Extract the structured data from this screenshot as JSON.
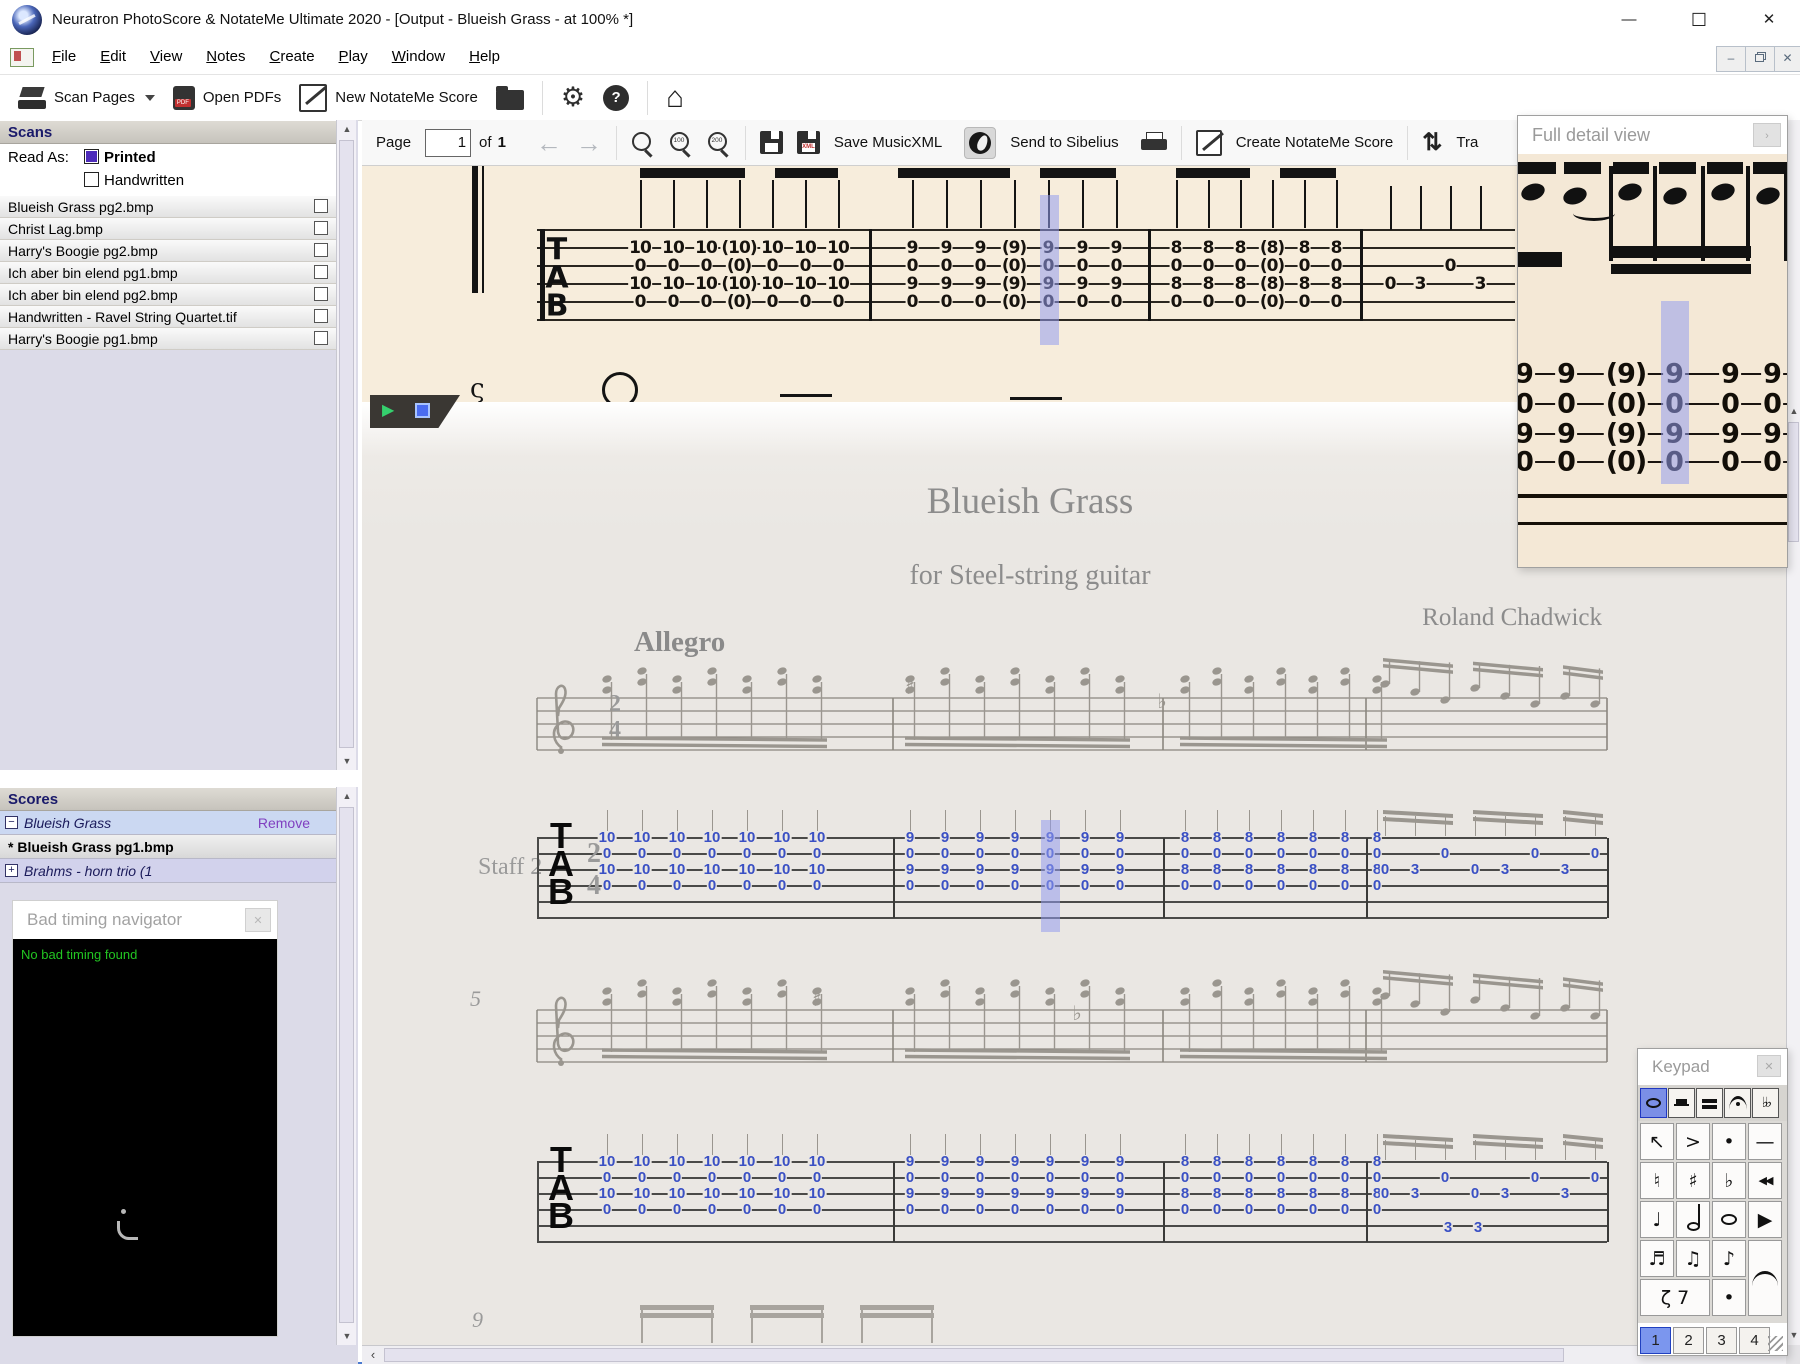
{
  "window": {
    "title": "Neuratron PhotoScore & NotateMe Ultimate 2020 - [Output - Blueish Grass - at 100% *]",
    "minimize_glyph": "—",
    "maximize_glyph": "☐",
    "close_glyph": "✕"
  },
  "menubar": {
    "items": [
      "File",
      "Edit",
      "View",
      "Notes",
      "Create",
      "Play",
      "Window",
      "Help"
    ]
  },
  "toolbar": {
    "scan_pages": "Scan Pages",
    "open_pdfs": "Open PDFs",
    "new_notateme": "New NotateMe Score"
  },
  "scans": {
    "title": "Scans",
    "read_as": "Read As:",
    "options": [
      {
        "label": "Printed",
        "checked": true
      },
      {
        "label": "Handwritten",
        "checked": false
      }
    ],
    "files": [
      "Blueish Grass pg2.bmp",
      "Christ Lag.bmp",
      "Harry's Boogie pg2.bmp",
      "Ich aber bin elend pg1.bmp",
      "Ich aber bin elend pg2.bmp",
      "Handwritten - Ravel String Quartet.tif",
      "Harry's Boogie pg1.bmp"
    ]
  },
  "scores": {
    "title": "Scores",
    "rows": [
      {
        "expander": "−",
        "label": "Blueish Grass",
        "italic": true,
        "action": "Remove",
        "style": "open"
      },
      {
        "expander": "",
        "label": "* Blueish Grass pg1.bmp",
        "bold": true,
        "style": "page"
      },
      {
        "expander": "+",
        "label": "Brahms - horn trio (1",
        "italic": true,
        "style": "collapsed"
      }
    ]
  },
  "bad_timing": {
    "title": "Bad timing navigator",
    "close_glyph": "✕",
    "message": "No bad timing found"
  },
  "output_toolbar": {
    "page_label": "Page",
    "page_value": "1",
    "of_label": "of",
    "of_value": "1",
    "zoom_100": "100",
    "zoom_200": "200",
    "save_musicxml": "Save MusicXML",
    "send_sibelius": "Send to Sibelius",
    "create_notateme": "Create NotateMe Score",
    "transpose_partial": "Tra"
  },
  "score": {
    "title": "Blueish Grass",
    "subtitle": "for Steel-string guitar",
    "composer": "Roland Chadwick",
    "tempo": "Allegro",
    "staff_label": "Staff 2",
    "clef": "TAB",
    "time_sig": [
      "2",
      "4"
    ],
    "system_measure_numbers": [
      "5",
      "9"
    ],
    "systems": [
      {
        "accidentals": [
          {
            "glyph": "♯"
          },
          {
            "glyph": "♭"
          }
        ],
        "measures": [
          {
            "type": "chords",
            "count": 7,
            "strings": [
              "10",
              "0",
              "10",
              "0"
            ]
          },
          {
            "type": "chords",
            "count": 7,
            "strings": [
              "9",
              "0",
              "9",
              "0"
            ],
            "highlight_col": 4
          },
          {
            "type": "chords",
            "count": 7,
            "strings": [
              "8",
              "0",
              "8",
              "0"
            ]
          },
          {
            "type": "melody",
            "notes": [
              {
                "string": 3,
                "fret": "0"
              },
              {
                "string": 3,
                "fret": "3"
              },
              {
                "string": 2,
                "fret": "0"
              },
              {
                "string": 3,
                "fret": "0"
              },
              {
                "string": 3,
                "fret": "3"
              },
              {
                "string": 2,
                "fret": "0"
              },
              {
                "string": 3,
                "fret": "3"
              },
              {
                "string": 2,
                "fret": "0"
              }
            ]
          }
        ]
      },
      {
        "accidentals": [
          {
            "glyph": "♯"
          },
          {
            "glyph": "♭"
          }
        ],
        "below_staff": [
          "3",
          "3"
        ],
        "measures": [
          {
            "type": "chords",
            "count": 7,
            "strings": [
              "10",
              "0",
              "10",
              "0"
            ]
          },
          {
            "type": "chords",
            "count": 7,
            "strings": [
              "9",
              "0",
              "9",
              "0"
            ]
          },
          {
            "type": "chords",
            "count": 7,
            "strings": [
              "8",
              "0",
              "8",
              "0"
            ]
          },
          {
            "type": "melody",
            "notes": [
              {
                "string": 3,
                "fret": "0"
              },
              {
                "string": 3,
                "fret": "3"
              },
              {
                "string": 2,
                "fret": "0"
              },
              {
                "string": 3,
                "fret": "0"
              },
              {
                "string": 3,
                "fret": "3"
              },
              {
                "string": 2,
                "fret": "0"
              },
              {
                "string": 3,
                "fret": "3"
              },
              {
                "string": 2,
                "fret": "0"
              }
            ]
          }
        ]
      }
    ]
  },
  "scan_view": {
    "clef": "TAB",
    "measures": [
      {
        "type": "chords",
        "count": 7,
        "strings": [
          "10",
          "0",
          "10",
          "0"
        ],
        "paren_col": 3
      },
      {
        "type": "chords",
        "count": 7,
        "strings": [
          "9",
          "0",
          "9",
          "0"
        ],
        "paren_col": 3,
        "highlight_col": 4
      },
      {
        "type": "chords",
        "count": 6,
        "strings": [
          "8",
          "0",
          "8",
          "0"
        ],
        "paren_col": 3
      },
      {
        "type": "melody",
        "notes": [
          {
            "string": 3,
            "fret": "0"
          },
          {
            "string": 3,
            "fret": "3"
          },
          {
            "string": 2,
            "fret": "0"
          },
          {
            "string": 3,
            "fret": "3"
          }
        ]
      }
    ]
  },
  "full_detail": {
    "title": "Full detail view",
    "columns": [
      {
        "vals": [
          "9",
          "0",
          "9",
          "0"
        ]
      },
      {
        "vals": [
          "9",
          "0",
          "9",
          "0"
        ]
      },
      {
        "vals": [
          "9",
          "0",
          "9",
          "0"
        ],
        "paren": true
      },
      {
        "vals": [
          "9",
          "0",
          "9",
          "0"
        ],
        "highlight": true
      },
      {
        "vals": [
          "9",
          "0",
          "9",
          "0"
        ]
      },
      {
        "vals": [
          "9",
          "0",
          "9",
          "0"
        ]
      }
    ]
  },
  "keypad": {
    "title": "Keypad",
    "close_glyph": "✕",
    "tabs": [
      {
        "name": "whole-note-tab",
        "shape": "oval",
        "selected": true
      },
      {
        "name": "half-rest-tab",
        "shape": "half-rest"
      },
      {
        "name": "whole-rest-tab",
        "shape": "whole-rest"
      },
      {
        "name": "fermata-tab",
        "shape": "fermata"
      },
      {
        "name": "double-flat-tab",
        "glyph": "♭♭"
      }
    ],
    "buttons": [
      {
        "name": "pointer",
        "glyph": "↖",
        "r": 1,
        "c": 1
      },
      {
        "name": "accent",
        "glyph": ">",
        "r": 1,
        "c": 2
      },
      {
        "name": "staccato",
        "glyph": "•",
        "r": 1,
        "c": 3
      },
      {
        "name": "tenuto",
        "glyph": "—",
        "r": 1,
        "c": 4
      },
      {
        "name": "natural",
        "glyph": "♮",
        "r": 2,
        "c": 1
      },
      {
        "name": "sharp",
        "glyph": "♯",
        "r": 2,
        "c": 2
      },
      {
        "name": "flat",
        "glyph": "♭",
        "r": 2,
        "c": 3
      },
      {
        "name": "rewind",
        "glyph": "◀◀",
        "r": 2,
        "c": 4
      },
      {
        "name": "quarter-note",
        "glyph": "♩",
        "r": 3,
        "c": 1
      },
      {
        "name": "half-note",
        "shape": "half-note",
        "r": 3,
        "c": 2
      },
      {
        "name": "whole-note",
        "shape": "whole-note",
        "r": 3,
        "c": 3
      },
      {
        "name": "play",
        "glyph": "▶",
        "r": 3,
        "c": 4
      },
      {
        "name": "sixteenth-note",
        "glyph": "♬",
        "r": 4,
        "c": 1
      },
      {
        "name": "eighth-note-pair",
        "glyph": "♫",
        "r": 4,
        "c": 2
      },
      {
        "name": "eighth-note",
        "glyph": "♪",
        "r": 4,
        "c": 3
      },
      {
        "name": "tie",
        "shape": "tie",
        "r": 4,
        "c": 4,
        "rs": 2
      },
      {
        "name": "rests",
        "glyph": "ζ 7",
        "r": 5,
        "c": 1,
        "cs": 2
      },
      {
        "name": "augmentation-dot",
        "glyph": "•",
        "r": 5,
        "c": 3
      }
    ],
    "voices": [
      "1",
      "2",
      "3",
      "4"
    ],
    "selected_voice": "1"
  }
}
